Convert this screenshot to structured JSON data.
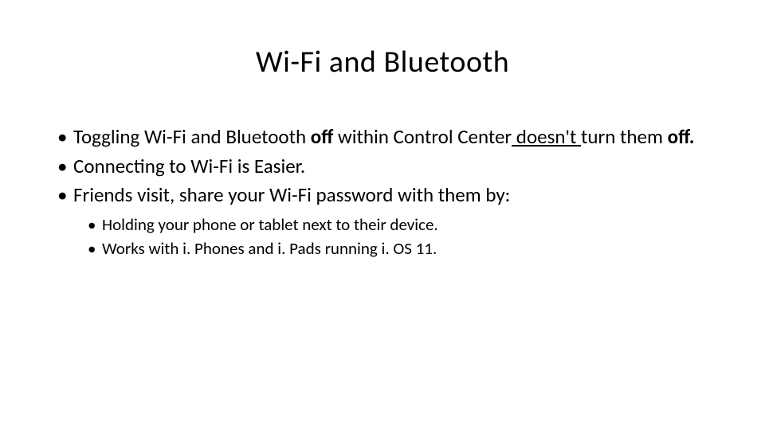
{
  "slide": {
    "title": "Wi-Fi and Bluetooth",
    "bullets": [
      {
        "segments": [
          {
            "text": "Toggling Wi-Fi and Bluetooth ",
            "bold": false,
            "underline": false
          },
          {
            "text": "off",
            "bold": true,
            "underline": false
          },
          {
            "text": " within Control Center",
            "bold": false,
            "underline": false
          },
          {
            "text": " doesn't ",
            "bold": false,
            "underline": true
          },
          {
            "text": "turn them ",
            "bold": false,
            "underline": false
          },
          {
            "text": "off.",
            "bold": true,
            "underline": false
          }
        ]
      },
      {
        "segments": [
          {
            "text": "Connecting to Wi-Fi is Easier.",
            "bold": false,
            "underline": false
          }
        ]
      },
      {
        "segments": [
          {
            "text": "Friends visit, share your Wi-Fi password with them by:",
            "bold": false,
            "underline": false
          }
        ],
        "sub_bullets": [
          {
            "text": "Holding your phone or tablet next to their device."
          },
          {
            "text": "Works with i. Phones and i. Pads running i. OS 11."
          }
        ]
      }
    ]
  }
}
